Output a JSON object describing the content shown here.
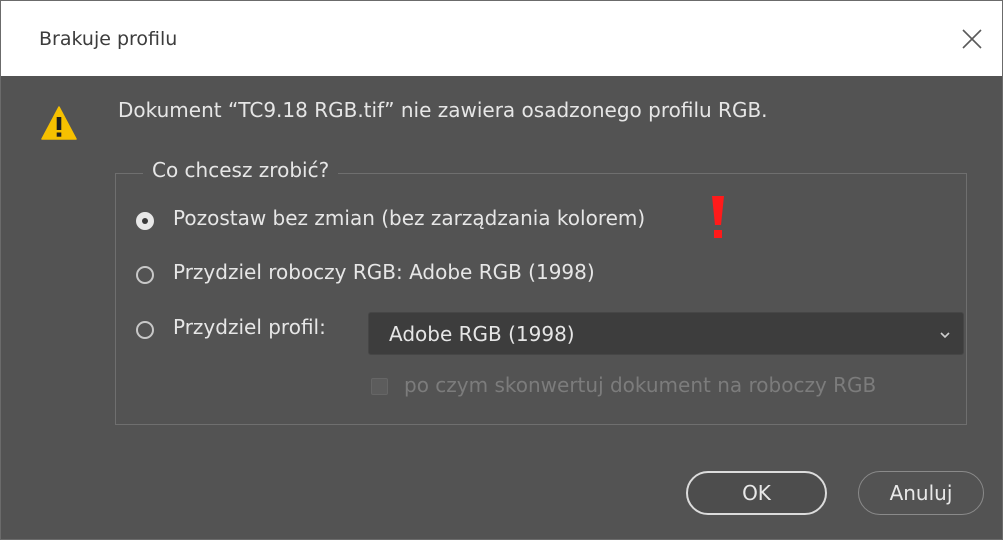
{
  "dialog": {
    "title": "Brakuje profilu",
    "message": "Dokument  “TC9.18 RGB.tif” nie zawiera osadzonego profilu RGB."
  },
  "group": {
    "legend": "Co chcesz zrobić?",
    "options": [
      {
        "label": "Pozostaw bez zmian (bez zarządzania kolorem)",
        "checked": true
      },
      {
        "label": "Przydziel roboczy RGB:  Adobe RGB (1998)",
        "checked": false
      },
      {
        "label": "Przydziel profil:",
        "checked": false
      }
    ],
    "profile_select": {
      "value": "Adobe RGB (1998)"
    },
    "convert_checkbox": {
      "label": "po czym skonwertuj dokument na roboczy RGB",
      "checked": false,
      "enabled": false
    }
  },
  "buttons": {
    "ok": "OK",
    "cancel": "Anuluj"
  },
  "icons": {
    "dialog": "warning-icon",
    "annotation": "exclamation-icon",
    "dropdown": "chevron-down-icon",
    "close": "close-icon"
  },
  "colors": {
    "background": "#535353",
    "warning": "#f6c000",
    "annotation": "#ff1a1a"
  }
}
